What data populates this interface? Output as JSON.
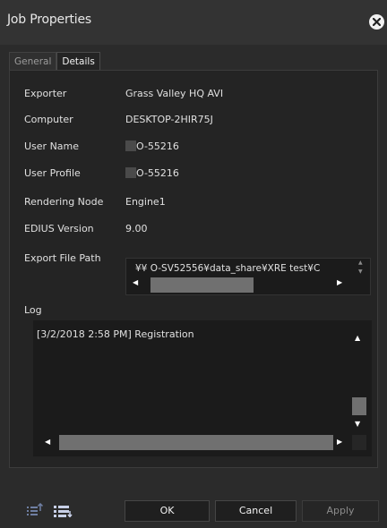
{
  "window": {
    "title": "Job Properties",
    "close_icon": "close-icon"
  },
  "tabs": [
    {
      "label": "General",
      "active": false
    },
    {
      "label": "Details",
      "active": true
    }
  ],
  "details": {
    "exporter": {
      "label": "Exporter",
      "value": "Grass Valley HQ AVI"
    },
    "computer": {
      "label": "Computer",
      "value": "DESKTOP-2HIR75J"
    },
    "user_name": {
      "label": "User Name",
      "value": "O-55216"
    },
    "user_profile": {
      "label": "User Profile",
      "value": "O-55216"
    },
    "rendering_node": {
      "label": "Rendering Node",
      "value": "Engine1"
    },
    "edius_version": {
      "label": "EDIUS Version",
      "value": "9.00"
    },
    "export_file_path": {
      "label": "Export File Path",
      "value": "¥¥  O-SV52556¥data_share¥XRE test¥C"
    }
  },
  "log": {
    "label": "Log",
    "text": "[3/2/2018 2:58 PM] Registration"
  },
  "buttons": {
    "ok": "OK",
    "cancel": "Cancel",
    "apply": "Apply"
  },
  "scroll_arrows": {
    "up": "▲",
    "down": "▼",
    "left": "◀",
    "right": "▶"
  },
  "colors": {
    "background": "#2b2b2b",
    "panel": "#242424",
    "field": "#1b1b1b",
    "scroll_thumb": "#707070"
  }
}
